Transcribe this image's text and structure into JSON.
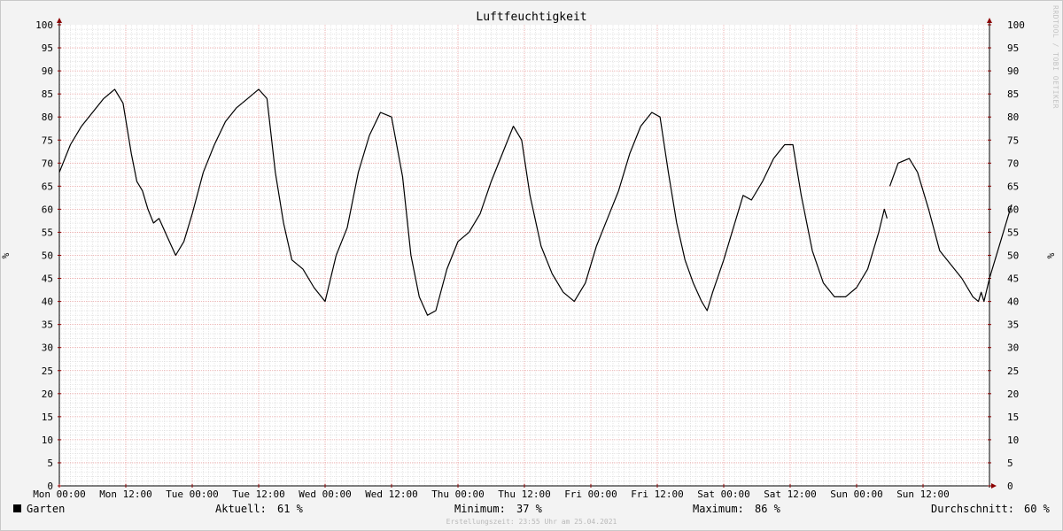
{
  "chart_data": {
    "type": "line",
    "title": "Luftfeuchtigkeit",
    "ylabel": "%",
    "ylim": [
      0,
      100
    ],
    "ytick_labels": [
      "0",
      "5",
      "10",
      "15",
      "20",
      "25",
      "30",
      "35",
      "40",
      "45",
      "50",
      "55",
      "60",
      "65",
      "70",
      "75",
      "80",
      "85",
      "90",
      "95",
      "100"
    ],
    "xlim": [
      "Mon 00:00",
      "Sun 24:00"
    ],
    "xtick_labels": [
      "Mon 00:00",
      "Mon 12:00",
      "Tue 00:00",
      "Tue 12:00",
      "Wed 00:00",
      "Wed 12:00",
      "Thu 00:00",
      "Thu 12:00",
      "Fri 00:00",
      "Fri 12:00",
      "Sat 00:00",
      "Sat 12:00",
      "Sun 00:00",
      "Sun 12:00"
    ],
    "grid": true,
    "series": [
      {
        "name": "Garten",
        "color": "#000000",
        "segments": [
          [
            [
              "Mon 00:00",
              68
            ],
            [
              "Mon 02:00",
              74
            ],
            [
              "Mon 04:00",
              78
            ],
            [
              "Mon 06:00",
              81
            ],
            [
              "Mon 08:00",
              84
            ],
            [
              "Mon 10:00",
              86
            ],
            [
              "Mon 11:30",
              83
            ],
            [
              "Mon 13:00",
              72
            ],
            [
              "Mon 14:00",
              66
            ],
            [
              "Mon 15:00",
              64
            ],
            [
              "Mon 16:00",
              60
            ],
            [
              "Mon 17:00",
              57
            ],
            [
              "Mon 18:00",
              58
            ],
            [
              "Mon 19:30",
              54
            ],
            [
              "Mon 21:00",
              50
            ],
            [
              "Mon 22:30",
              53
            ],
            [
              "Tue 00:00",
              59
            ],
            [
              "Tue 02:00",
              68
            ],
            [
              "Tue 04:00",
              74
            ],
            [
              "Tue 06:00",
              79
            ],
            [
              "Tue 08:00",
              82
            ],
            [
              "Tue 10:00",
              84
            ],
            [
              "Tue 12:00",
              86
            ],
            [
              "Tue 13:30",
              84
            ],
            [
              "Tue 15:00",
              68
            ],
            [
              "Tue 16:30",
              57
            ],
            [
              "Tue 18:00",
              49
            ],
            [
              "Tue 20:00",
              47
            ],
            [
              "Tue 22:00",
              43
            ],
            [
              "Wed 00:00",
              40
            ],
            [
              "Wed 02:00",
              50
            ],
            [
              "Wed 04:00",
              56
            ],
            [
              "Wed 06:00",
              68
            ],
            [
              "Wed 08:00",
              76
            ],
            [
              "Wed 10:00",
              81
            ],
            [
              "Wed 12:00",
              80
            ],
            [
              "Wed 14:00",
              67
            ],
            [
              "Wed 15:30",
              50
            ],
            [
              "Wed 17:00",
              41
            ],
            [
              "Wed 18:30",
              37
            ],
            [
              "Wed 20:00",
              38
            ],
            [
              "Wed 22:00",
              47
            ],
            [
              "Thu 00:00",
              53
            ],
            [
              "Thu 02:00",
              55
            ],
            [
              "Thu 04:00",
              59
            ],
            [
              "Thu 06:00",
              66
            ],
            [
              "Thu 08:00",
              72
            ],
            [
              "Thu 10:00",
              78
            ],
            [
              "Thu 11:30",
              75
            ],
            [
              "Thu 13:00",
              63
            ],
            [
              "Thu 15:00",
              52
            ],
            [
              "Thu 17:00",
              46
            ],
            [
              "Thu 19:00",
              42
            ],
            [
              "Thu 21:00",
              40
            ],
            [
              "Thu 23:00",
              44
            ],
            [
              "Fri 01:00",
              52
            ],
            [
              "Fri 03:00",
              58
            ],
            [
              "Fri 05:00",
              64
            ],
            [
              "Fri 07:00",
              72
            ],
            [
              "Fri 09:00",
              78
            ],
            [
              "Fri 11:00",
              81
            ],
            [
              "Fri 12:30",
              80
            ],
            [
              "Fri 14:00",
              68
            ],
            [
              "Fri 15:30",
              57
            ],
            [
              "Fri 17:00",
              49
            ],
            [
              "Fri 18:30",
              44
            ],
            [
              "Fri 20:00",
              40
            ],
            [
              "Fri 21:00",
              38
            ],
            [
              "Fri 22:00",
              42
            ],
            [
              "Sat 00:00",
              49
            ],
            [
              "Sat 02:00",
              57
            ],
            [
              "Sat 03:30",
              63
            ],
            [
              "Sat 05:00",
              62
            ],
            [
              "Sat 07:00",
              66
            ],
            [
              "Sat 09:00",
              71
            ],
            [
              "Sat 11:00",
              74
            ],
            [
              "Sat 12:30",
              74
            ],
            [
              "Sat 14:00",
              63
            ],
            [
              "Sat 16:00",
              51
            ],
            [
              "Sat 18:00",
              44
            ],
            [
              "Sat 20:00",
              41
            ],
            [
              "Sat 22:00",
              41
            ],
            [
              "Sun 00:00",
              43
            ],
            [
              "Sun 02:00",
              47
            ],
            [
              "Sun 04:00",
              55
            ],
            [
              "Sun 05:00",
              60
            ],
            [
              "Sun 05:30",
              58
            ]
          ],
          [
            [
              "Sun 06:00",
              65
            ],
            [
              "Sun 07:30",
              70
            ],
            [
              "Sun 09:30",
              71
            ],
            [
              "Sun 11:00",
              68
            ],
            [
              "Sun 13:00",
              60
            ],
            [
              "Sun 15:00",
              51
            ],
            [
              "Sun 17:00",
              48
            ],
            [
              "Sun 19:00",
              45
            ],
            [
              "Sun 21:00",
              41
            ],
            [
              "Sun 22:00",
              40
            ],
            [
              "Sun 22:30",
              42
            ],
            [
              "Sun 23:00",
              40
            ],
            [
              "Sun 24:00",
              45
            ],
            [
              "Sun 26:00",
              53
            ],
            [
              "Sun 28:00",
              61
            ]
          ]
        ]
      }
    ]
  },
  "legend": {
    "series_name": "Garten",
    "current_label": "Aktuell:",
    "current_value": "61 %",
    "min_label": "Minimum:",
    "min_value": "37 %",
    "max_label": "Maximum:",
    "max_value": "86 %",
    "avg_label": "Durchschnitt:",
    "avg_value": "60 %"
  },
  "footer": "Erstellungszeit: 23:55 Uhr am 25.04.2021",
  "watermark": "RRDTOOL / TOBI OETIKER",
  "colors": {
    "background": "#f3f3f3",
    "plot_background": "#ffffff",
    "minor_grid": "#d8d8d8",
    "major_grid": "#e8a0a0",
    "axis": "#000000",
    "axis_arrow": "#8b0000"
  }
}
